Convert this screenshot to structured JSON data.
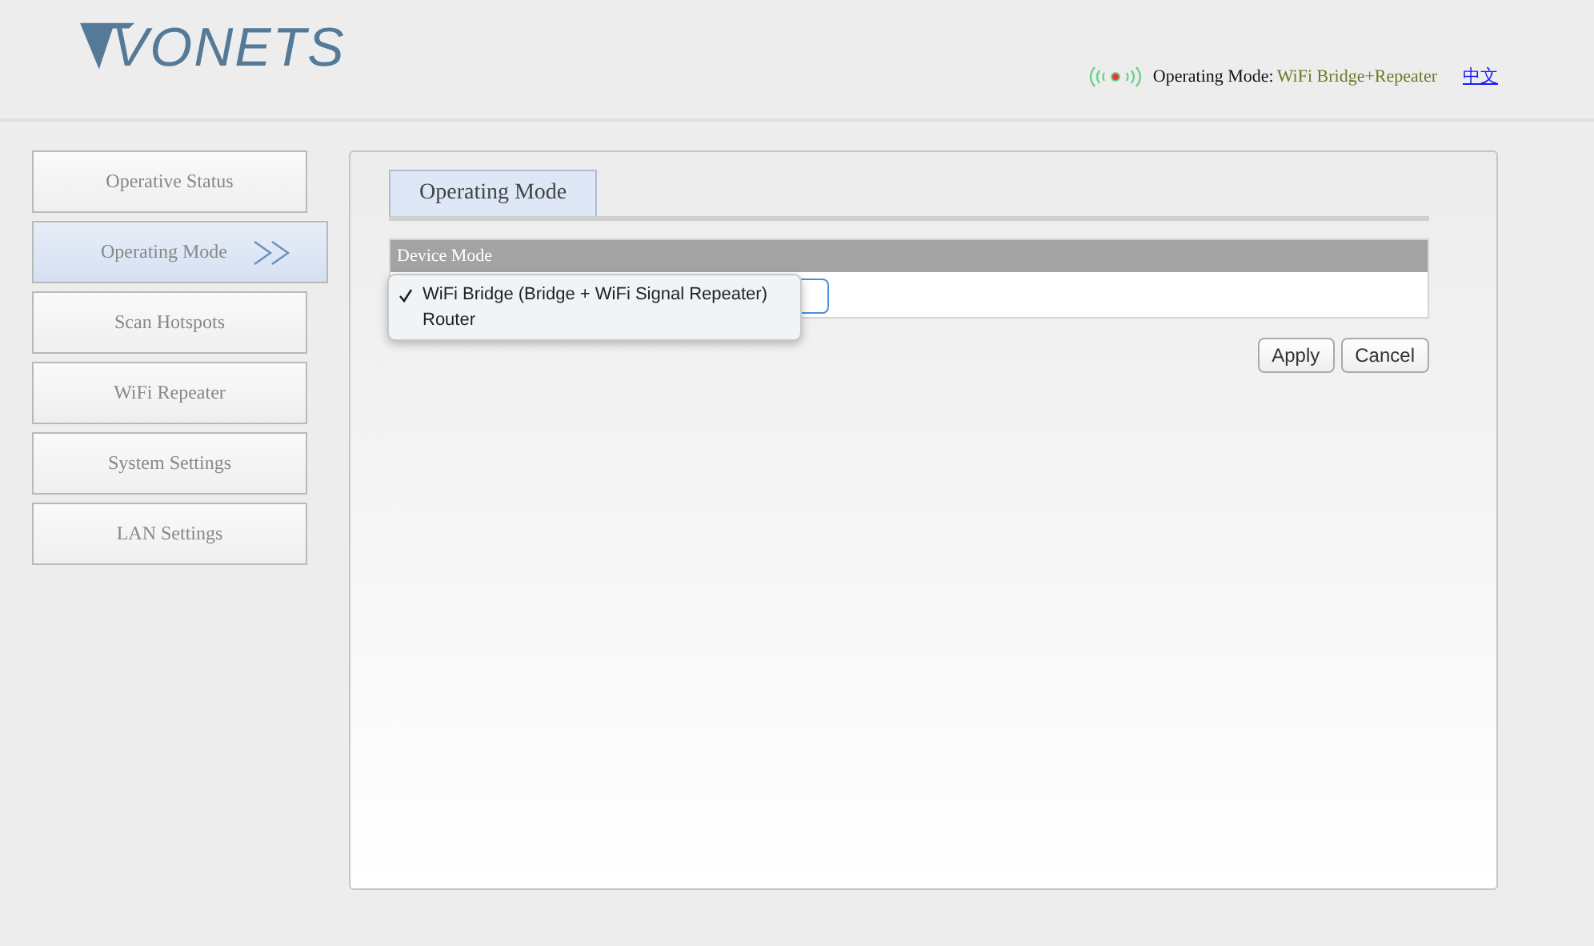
{
  "header": {
    "logo": "VONETS",
    "status_label": "Operating Mode:",
    "status_value": "WiFi Bridge+Repeater",
    "language_link": "中文"
  },
  "sidebar": {
    "items": [
      {
        "label": "Operative Status",
        "selected": false
      },
      {
        "label": "Operating Mode",
        "selected": true
      },
      {
        "label": "Scan Hotspots",
        "selected": false
      },
      {
        "label": "WiFi Repeater",
        "selected": false
      },
      {
        "label": "System Settings",
        "selected": false
      },
      {
        "label": "LAN Settings",
        "selected": false
      }
    ]
  },
  "panel": {
    "tab": "Operating Mode",
    "table_header": "Device Mode",
    "dropdown": {
      "expanded": true,
      "options": [
        {
          "label": "WiFi Bridge (Bridge + WiFi Signal Repeater)",
          "selected": true
        },
        {
          "label": "Router",
          "selected": false
        }
      ]
    },
    "buttons": [
      "Apply",
      "Cancel"
    ]
  }
}
